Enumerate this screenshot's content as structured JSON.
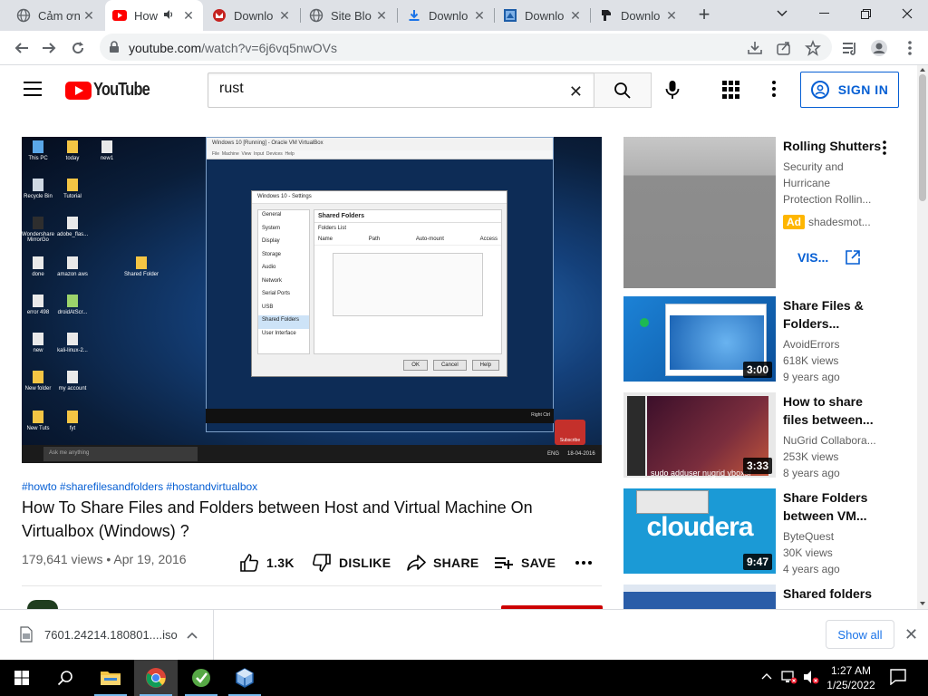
{
  "browser": {
    "tabs": [
      {
        "label": "Cảm ơn",
        "icon": "globe-icon"
      },
      {
        "label": "How",
        "icon": "youtube-icon",
        "active": true,
        "audio": true
      },
      {
        "label": "Downlo",
        "icon": "gmail-icon"
      },
      {
        "label": "Site Blo",
        "icon": "globe-icon"
      },
      {
        "label": "Downlo",
        "icon": "download-icon"
      },
      {
        "label": "Downlo",
        "icon": "virtualbox-icon"
      },
      {
        "label": "Downlo",
        "icon": "rust-icon"
      }
    ],
    "url_host": "youtube.com",
    "url_path": "/watch?v=6j6vq5nwOVs"
  },
  "youtube": {
    "logo_text": "YouTube",
    "search_value": "rust",
    "signin_label": "SIGN IN"
  },
  "video": {
    "hashtags": "#howto #sharefilesandfolders #hostandvirtualbox",
    "title": "How To Share Files and Folders between Host and Virtual Machine On Virtualbox (Windows) ?",
    "meta": "179,641 views • Apr 19, 2016",
    "likes": "1.3K",
    "dislike_label": "DISLIKE",
    "share_label": "SHARE",
    "save_label": "SAVE"
  },
  "screen_content": {
    "desktop_icons": [
      "This PC",
      "Recycle Bin",
      "Wondershare MirrorGo",
      "done",
      "error 498",
      "new",
      "New folder",
      "New Tuts",
      "today",
      "Tutorial",
      "adobe_flas...",
      "amazon aws",
      "droidAtScr...",
      "kali-linux-2...",
      "my account",
      "fyt",
      "new1",
      "Shared Folder"
    ],
    "vm_title": "Windows 10 [Running] - Oracle VM VirtualBox",
    "settings_title": "Windows 10 - Settings",
    "settings_menu": [
      "General",
      "System",
      "Display",
      "Storage",
      "Audio",
      "Network",
      "Serial Ports",
      "USB",
      "Shared Folders",
      "User Interface"
    ],
    "panel_heading": "Shared Folders",
    "panel_sub": "Folders List",
    "panel_cols": [
      "Name",
      "Path",
      "Auto-mount",
      "Access"
    ],
    "buttons": [
      "OK",
      "Cancel",
      "Help"
    ],
    "host_search": "Ask me anything",
    "subscribe": "Subscribe",
    "vm_right_ctrl": "Right Ctrl",
    "date": "18-04-2016",
    "lang": "ENG"
  },
  "sidebar": [
    {
      "title": "Rolling Shutters",
      "channel": "Security and Hurricane Protection Rollin...",
      "ad_label": "Ad",
      "ad_channel": "shadesmot...",
      "cta": "VIS...",
      "thumb_color": "#9a9a9a"
    },
    {
      "title": "Share Files & Folders...",
      "channel": "AvoidErrors",
      "views": "618K views",
      "age": "9 years ago",
      "duration": "3:00",
      "thumb_color": "#1570c9"
    },
    {
      "title": "How to share files between...",
      "channel": "NuGrid Collabora...",
      "views": "253K views",
      "age": "8 years ago",
      "duration": "3:33",
      "thumb_color": "#5b2240",
      "caption": "sudo adduser nugrid vboxsf"
    },
    {
      "title": "Share Folders between VM...",
      "channel": "ByteQuest",
      "views": "30K views",
      "age": "4 years ago",
      "duration": "9:47",
      "thumb_color": "#1b9ad6",
      "logo": "cloudera"
    },
    {
      "title": "Shared folders",
      "thumb_color": "#2a5da8"
    }
  ],
  "downloads": {
    "file": "7601.24214.180801....iso",
    "show_all": "Show all"
  },
  "taskbar": {
    "time": "1:27 AM",
    "date": "1/25/2022"
  },
  "colors": {
    "yt_red": "#ff0000",
    "link_blue": "#065fd4",
    "chrome_gray": "#dee1e6"
  }
}
